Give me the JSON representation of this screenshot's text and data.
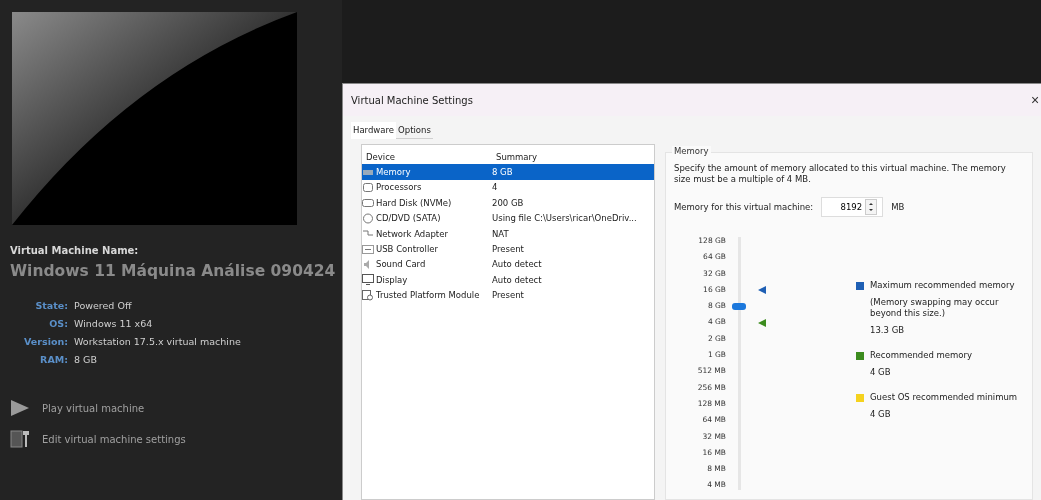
{
  "vm": {
    "name_label": "Virtual Machine Name:",
    "name": "Windows 11 Máquina Análise 090424",
    "details": [
      {
        "label": "State:",
        "value": "Powered Off"
      },
      {
        "label": "OS:",
        "value": "Windows 11 x64"
      },
      {
        "label": "Version:",
        "value": "Workstation 17.5.x virtual machine"
      },
      {
        "label": "RAM:",
        "value": "8 GB"
      }
    ],
    "actions": [
      {
        "kind": "play",
        "label": "Play virtual machine"
      },
      {
        "kind": "edit",
        "label": "Edit virtual machine settings"
      }
    ]
  },
  "dialog": {
    "title": "Virtual Machine Settings",
    "close": "×",
    "tabs": [
      {
        "label": "Hardware",
        "selected": true
      },
      {
        "label": "Options",
        "selected": false
      }
    ],
    "device_columns": [
      "Device",
      "Summary"
    ],
    "devices": [
      {
        "kind": "memory",
        "name": "Memory",
        "summary": "8 GB",
        "selected": true
      },
      {
        "kind": "cpu",
        "name": "Processors",
        "summary": "4",
        "selected": false
      },
      {
        "kind": "disk",
        "name": "Hard Disk (NVMe)",
        "summary": "200 GB",
        "selected": false
      },
      {
        "kind": "cd",
        "name": "CD/DVD (SATA)",
        "summary": "Using file C:\\Users\\ricar\\OneDriv...",
        "selected": false
      },
      {
        "kind": "network",
        "name": "Network Adapter",
        "summary": "NAT",
        "selected": false
      },
      {
        "kind": "usb",
        "name": "USB Controller",
        "summary": "Present",
        "selected": false
      },
      {
        "kind": "sound",
        "name": "Sound Card",
        "summary": "Auto detect",
        "selected": false
      },
      {
        "kind": "display",
        "name": "Display",
        "summary": "Auto detect",
        "selected": false
      },
      {
        "kind": "tpm",
        "name": "Trusted Platform Module",
        "summary": "Present",
        "selected": false
      }
    ],
    "memory": {
      "group_title": "Memory",
      "description": "Specify the amount of memory allocated to this virtual machine. The memory size must be a multiple of 4 MB.",
      "field_label": "Memory for this virtual machine:",
      "field_value": "8192",
      "unit": "MB",
      "scale": [
        "128 GB",
        "64 GB",
        "32 GB",
        "16 GB",
        "8 GB",
        "4 GB",
        "2 GB",
        "1 GB",
        "512 MB",
        "256 MB",
        "128 MB",
        "64 MB",
        "32 MB",
        "16 MB",
        "8 MB",
        "4 MB"
      ],
      "level": 0.733,
      "markers": [
        {
          "level": 0.8,
          "color": "#1e5fb4"
        },
        {
          "level": 0.667,
          "color": "#3c8c1e"
        }
      ],
      "legend": [
        {
          "label": "Maximum recommended memory",
          "note": "(Memory swapping may occur beyond this size.)",
          "value": "13.3 GB",
          "color": "#1e5fb4"
        },
        {
          "label": "Recommended memory",
          "value": "4 GB",
          "color": "#3c8c1e"
        },
        {
          "label": "Guest OS recommended minimum",
          "value": "4 GB",
          "color": "#f5d21e"
        }
      ]
    }
  }
}
